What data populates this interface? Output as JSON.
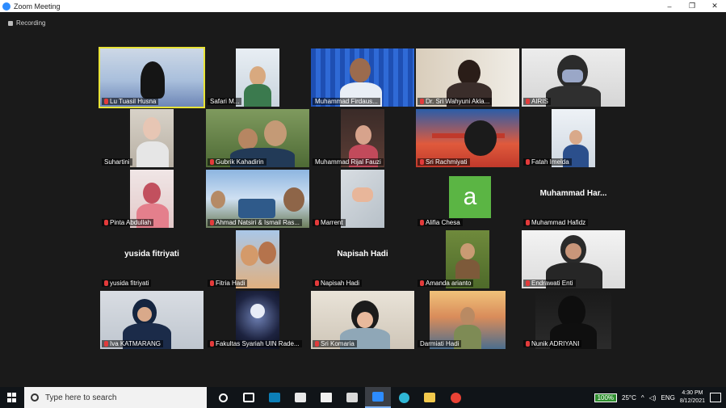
{
  "window": {
    "title": "Zoom Meeting",
    "controls": [
      "–",
      "❐",
      "✕"
    ]
  },
  "recording_label": "Recording",
  "participants": [
    {
      "name": "Lu Tuasil Husna"
    },
    {
      "name": "Safari M..."
    },
    {
      "name": "Muhammad Firdaus..."
    },
    {
      "name": "Dr. Sri Wahyuni Akla..."
    },
    {
      "name": "AIRIS"
    },
    {
      "name": "Suhartini"
    },
    {
      "name": "Gubrik Kahadirin"
    },
    {
      "name": "Muhammad Rijal Fauzi"
    },
    {
      "name": "Sri Rachmiyati"
    },
    {
      "name": "Fatah Imelda"
    },
    {
      "name": "Pinta Abdullah"
    },
    {
      "name": "Ahmad Natsiri & Ismail Ras..."
    },
    {
      "name": "Marrent"
    },
    {
      "name": "Alifia Chesa"
    },
    {
      "name": "Muhammad Hafidz",
      "big": "Muhammad Har..."
    },
    {
      "name": "yusida fitriyati",
      "big": "yusida fitriyati"
    },
    {
      "name": "Fitria Hadi"
    },
    {
      "name": "Napisah Hadi",
      "big": "Napisah Hadi"
    },
    {
      "name": "Amanda arianto"
    },
    {
      "name": "Endrawati Enti"
    },
    {
      "name": "Iva KATMARANG"
    },
    {
      "name": "Fakultas Syariah UIN Rade..."
    },
    {
      "name": "Sri Komaria"
    },
    {
      "name": "Darmiati Hadi"
    },
    {
      "name": "Nunik ADRIYANI"
    }
  ],
  "taskbar": {
    "search_placeholder": "Type here to search",
    "battery": "100%",
    "temperature": "25°C",
    "language": "ENG",
    "time": "4:30 PM",
    "date": "8/12/2021"
  }
}
